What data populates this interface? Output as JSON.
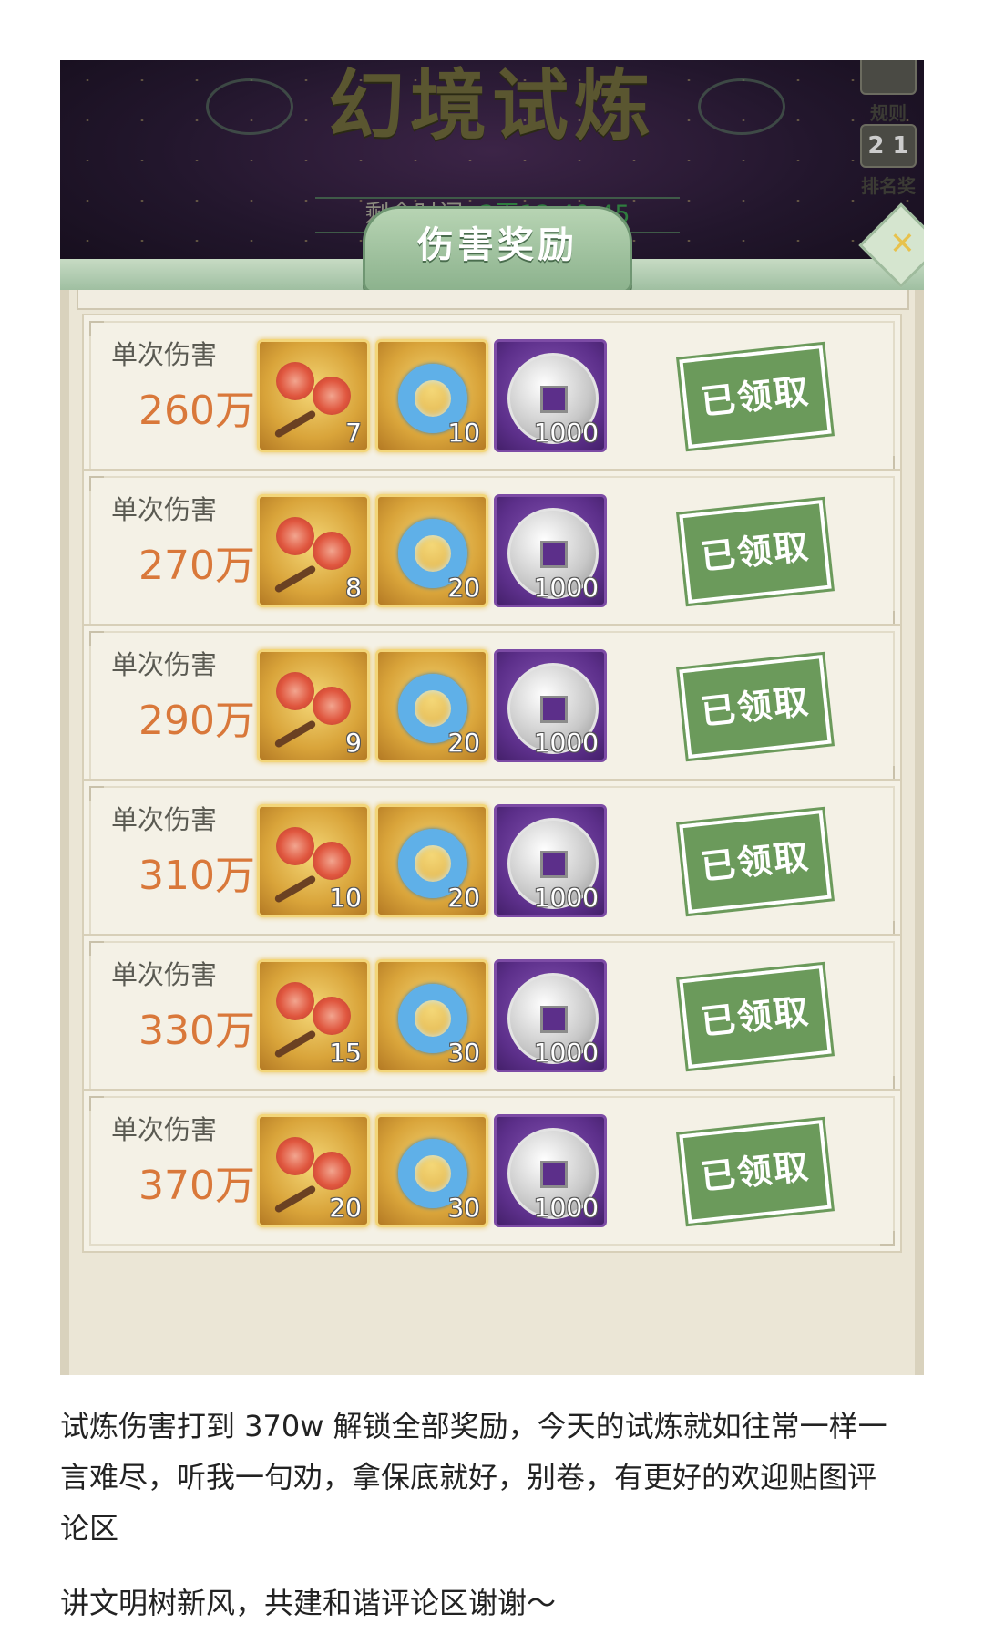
{
  "game": {
    "title": "幻境试炼",
    "timer_label": "剩余时间:",
    "timer_value": "2天12:49:45",
    "rules_label": "规则",
    "rank_label": "排名奖",
    "rank_icon_text": "2 1",
    "section_title": "伤害奖励",
    "close_symbol": "✕"
  },
  "rewards": [
    {
      "label": "单次伤害",
      "damage": "260万",
      "flower": "7",
      "jade": "10",
      "coin": "1000",
      "status": "已领取"
    },
    {
      "label": "单次伤害",
      "damage": "270万",
      "flower": "8",
      "jade": "20",
      "coin": "1000",
      "status": "已领取"
    },
    {
      "label": "单次伤害",
      "damage": "290万",
      "flower": "9",
      "jade": "20",
      "coin": "1000",
      "status": "已领取"
    },
    {
      "label": "单次伤害",
      "damage": "310万",
      "flower": "10",
      "jade": "20",
      "coin": "1000",
      "status": "已领取"
    },
    {
      "label": "单次伤害",
      "damage": "330万",
      "flower": "15",
      "jade": "30",
      "coin": "1000",
      "status": "已领取"
    },
    {
      "label": "单次伤害",
      "damage": "370万",
      "flower": "20",
      "jade": "30",
      "coin": "1000",
      "status": "已领取"
    }
  ],
  "caption": {
    "line1": "试炼伤害打到 370w 解锁全部奖励，今天的试炼就如往常一样一",
    "line2": "言难尽，听我一句劝，拿保底就好，别卷，有更好的欢迎贴图评",
    "line3": "论区",
    "line4": "讲文明树新风，共建和谐评论区谢谢～"
  },
  "colors": {
    "damage": "#d9783a",
    "stamp": "#6b9a5b",
    "timer_value": "#2f7d3f"
  }
}
